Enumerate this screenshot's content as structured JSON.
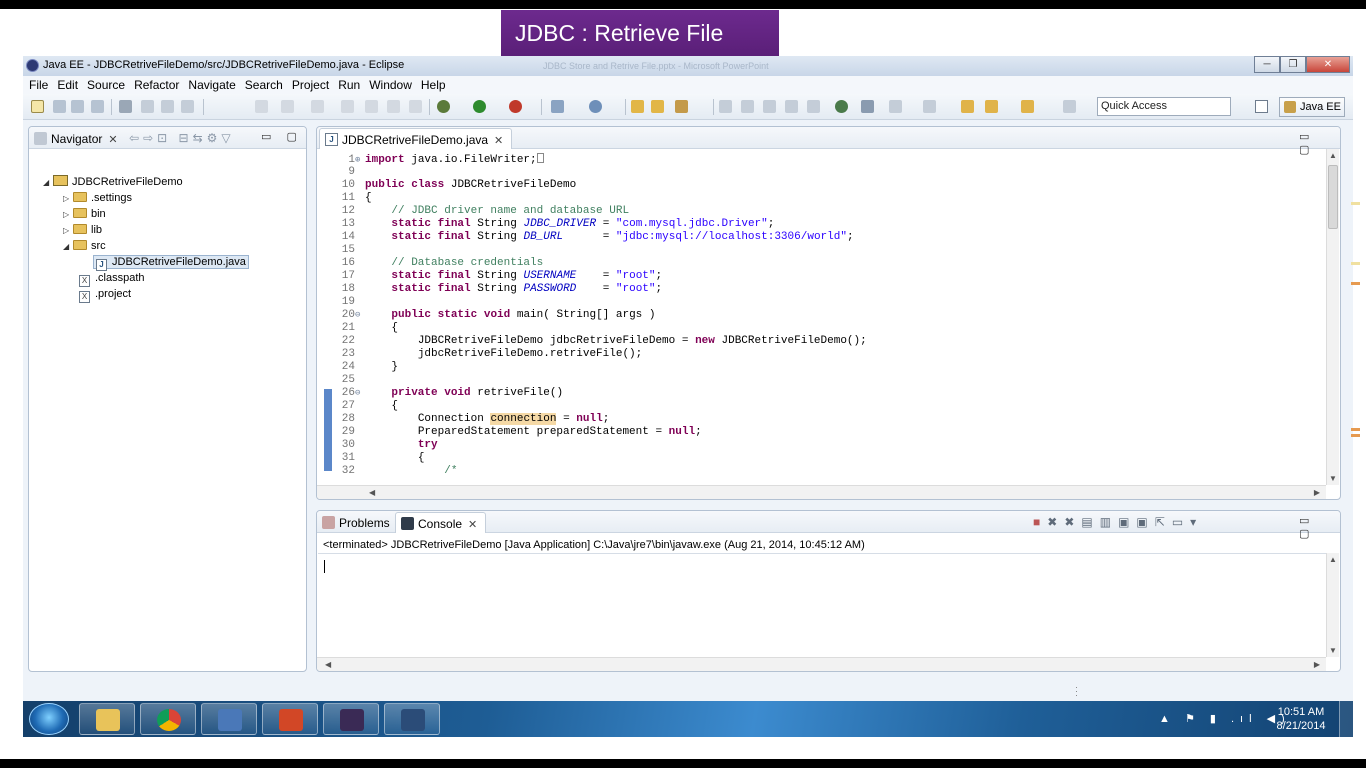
{
  "slide": {
    "title": "JDBC : Retrieve File"
  },
  "window": {
    "title": "Java EE - JDBCRetriveFileDemo/src/JDBCRetriveFileDemo.java - Eclipse",
    "ghost_title": "JDBC Store and Retrive File.pptx - Microsoft PowerPoint",
    "controls": {
      "minimize": "─",
      "restore": "❐",
      "close": "✕"
    }
  },
  "menu": [
    "File",
    "Edit",
    "Source",
    "Refactor",
    "Navigate",
    "Search",
    "Project",
    "Run",
    "Window",
    "Help"
  ],
  "toolbar": {
    "quick_access_placeholder": "Quick Access",
    "perspective_label": "Java EE"
  },
  "navigator": {
    "tab_label": "Navigator",
    "tab_close": "✕",
    "panel_controls": "▭ ▢",
    "tree": {
      "project": "JDBCRetriveFileDemo",
      "settings": ".settings",
      "bin": "bin",
      "lib": "lib",
      "src": "src",
      "java_file": "JDBCRetriveFileDemo.java",
      "classpath": ".classpath",
      "project_file": ".project"
    }
  },
  "editor": {
    "tab_label": "JDBCRetriveFileDemo.java",
    "tab_close": "✕",
    "panel_controls": "▭ ▢",
    "lines": [
      {
        "n": "1",
        "marker": "⊕"
      },
      {
        "n": "9",
        "marker": ""
      },
      {
        "n": "10",
        "marker": ""
      },
      {
        "n": "11",
        "marker": ""
      },
      {
        "n": "12",
        "marker": ""
      },
      {
        "n": "13",
        "marker": ""
      },
      {
        "n": "14",
        "marker": ""
      },
      {
        "n": "15",
        "marker": ""
      },
      {
        "n": "16",
        "marker": ""
      },
      {
        "n": "17",
        "marker": ""
      },
      {
        "n": "18",
        "marker": ""
      },
      {
        "n": "19",
        "marker": ""
      },
      {
        "n": "20",
        "marker": "⊖"
      },
      {
        "n": "21",
        "marker": ""
      },
      {
        "n": "22",
        "marker": ""
      },
      {
        "n": "23",
        "marker": ""
      },
      {
        "n": "24",
        "marker": ""
      },
      {
        "n": "25",
        "marker": ""
      },
      {
        "n": "26",
        "marker": "⊖"
      },
      {
        "n": "27",
        "marker": ""
      },
      {
        "n": "28",
        "marker": ""
      },
      {
        "n": "29",
        "marker": ""
      },
      {
        "n": "30",
        "marker": ""
      },
      {
        "n": "31",
        "marker": ""
      },
      {
        "n": "32",
        "marker": ""
      }
    ],
    "tokens": {
      "import": "import",
      "import_path": "java.io.FileWriter;",
      "public": "public",
      "class": "class",
      "class_name": "JDBCRetriveFileDemo",
      "brace_open": "{",
      "brace_close": "}",
      "comment_driver": "// JDBC driver name and database URL",
      "static": "static",
      "final": "final",
      "string_type": "String",
      "jdbc_driver": "JDBC_DRIVER",
      "eq": "=",
      "driver_value": "\"com.mysql.jdbc.Driver\"",
      "semi": ";",
      "db_url": "DB_URL",
      "url_value": "\"jdbc:mysql://localhost:3306/world\"",
      "comment_cred": "// Database credentials",
      "username": "USERNAME",
      "root_value": "\"root\"",
      "password": "PASSWORD",
      "void": "void",
      "main_sig": "main( String[] args )",
      "main_body1_a": "JDBCRetriveFileDemo jdbcRetriveFileDemo =",
      "new": "new",
      "main_body1_b": "JDBCRetriveFileDemo();",
      "main_body2": "jdbcRetriveFileDemo.retriveFile();",
      "private": "private",
      "retrive_sig": "retriveFile()",
      "conn_type": "Connection",
      "conn_var": "connection",
      "null": "null",
      "ps_decl": "PreparedStatement preparedStatement =",
      "try": "try",
      "comment_open": "/*"
    }
  },
  "console": {
    "tab_problems": "Problems",
    "tab_console": "Console",
    "tab_close": "✕",
    "panel_controls": "▭ ▢",
    "terminated_text": "<terminated> JDBCRetriveFileDemo [Java Application] C:\\Java\\jre7\\bin\\javaw.exe (Aug 21, 2014, 10:45:12 AM)"
  },
  "taskbar": {
    "clock_time": "10:51 AM",
    "clock_date": "8/21/2014",
    "tray_icons": "▲ ⚑ ▮ .ıl ◀)",
    "apps": [
      "Windows Explorer",
      "Google Chrome",
      "TextPad",
      "PowerPoint",
      "Java EE IDE",
      "Eclipse"
    ]
  },
  "colors": {
    "keyword": "#7f0055",
    "comment": "#3f7f5f",
    "string": "#2a00ff",
    "field": "#0000c0",
    "slide_accent": "#5a1f78"
  }
}
